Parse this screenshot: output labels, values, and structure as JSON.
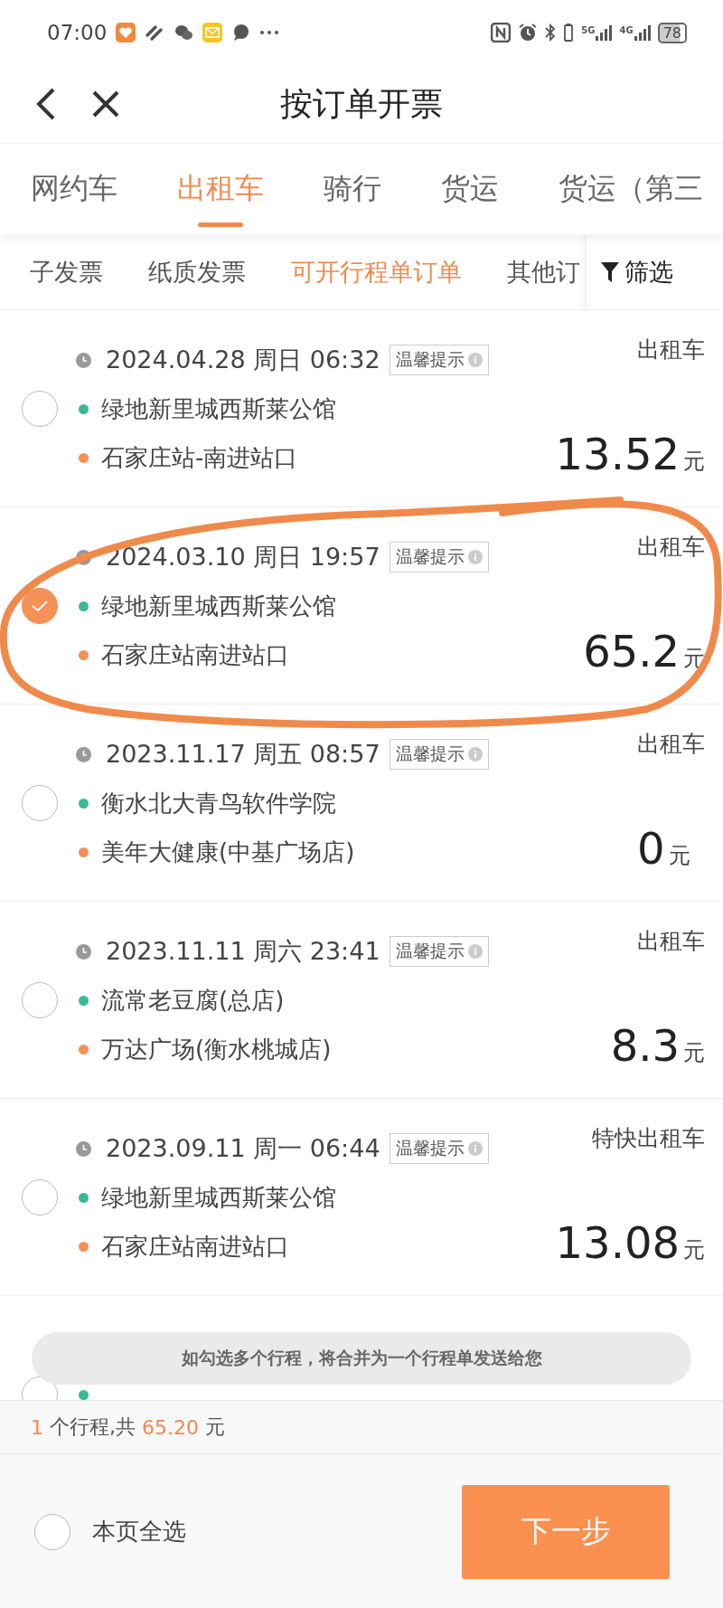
{
  "status_bar": {
    "time": "07:00",
    "network_1": "5G",
    "network_2": "4G",
    "battery": "78"
  },
  "header": {
    "title": "按订单开票"
  },
  "tabs": [
    {
      "label": "网约车",
      "selected": false
    },
    {
      "label": "出租车",
      "selected": true
    },
    {
      "label": "骑行",
      "selected": false
    },
    {
      "label": "货运",
      "selected": false
    },
    {
      "label": "货运（第三",
      "selected": false
    }
  ],
  "subtabs": [
    {
      "label": "子发票",
      "selected": false
    },
    {
      "label": "纸质发票",
      "selected": false
    },
    {
      "label": "可开行程单订单",
      "selected": true
    },
    {
      "label": "其他订",
      "selected": false
    }
  ],
  "filter": {
    "label": "筛选"
  },
  "orders": [
    {
      "date": "2024.04.28 周日 06:32",
      "tip": "温馨提示",
      "type": "出租车",
      "origin": "绿地新里城西斯莱公馆",
      "destination": "石家庄站-南进站口",
      "amount": "13.52",
      "unit": "元",
      "selected": false,
      "circled": false
    },
    {
      "date": "2024.03.10 周日 19:57",
      "tip": "温馨提示",
      "type": "出租车",
      "origin": "绿地新里城西斯莱公馆",
      "destination": "石家庄站南进站口",
      "amount": "65.2",
      "unit": "元",
      "selected": true,
      "circled": true
    },
    {
      "date": "2023.11.17 周五 08:57",
      "tip": "温馨提示",
      "type": "出租车",
      "origin": "衡水北大青鸟软件学院",
      "destination": "美年大健康(中基广场店)",
      "amount": "0",
      "unit": "元",
      "selected": false,
      "circled": false
    },
    {
      "date": "2023.11.11 周六 23:41",
      "tip": "温馨提示",
      "type": "出租车",
      "origin": "流常老豆腐(总店)",
      "destination": "万达广场(衡水桃城店)",
      "amount": "8.3",
      "unit": "元",
      "selected": false,
      "circled": false
    },
    {
      "date": "2023.09.11 周一 06:44",
      "tip": "温馨提示",
      "type": "特快出租车",
      "origin": "绿地新里城西斯莱公馆",
      "destination": "石家庄站南进站口",
      "amount": "13.08",
      "unit": "元",
      "selected": false,
      "circled": false
    },
    {
      "selected": false,
      "circled": false
    }
  ],
  "toast": "如勾选多个行程，将合并为一个行程单发送给您",
  "summary": {
    "count": "1",
    "count_label": "个行程,共",
    "total": "65.20",
    "unit": "元"
  },
  "select_all": {
    "label": "本页全选",
    "checked": false
  },
  "next_button": "下一步"
}
